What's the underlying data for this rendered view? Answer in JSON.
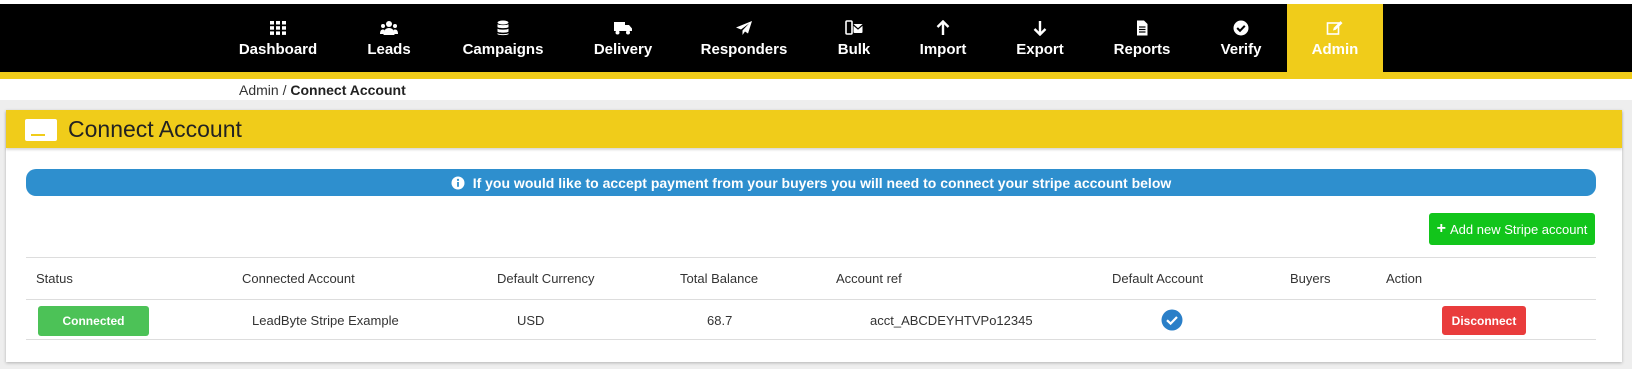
{
  "nav": {
    "items": [
      {
        "label": "Dashboard",
        "icon": "dashboard-icon"
      },
      {
        "label": "Leads",
        "icon": "users-icon"
      },
      {
        "label": "Campaigns",
        "icon": "database-icon"
      },
      {
        "label": "Delivery",
        "icon": "truck-icon"
      },
      {
        "label": "Responders",
        "icon": "paper-plane-icon"
      },
      {
        "label": "Bulk",
        "icon": "bulk-mail-icon"
      },
      {
        "label": "Import",
        "icon": "arrow-up-icon"
      },
      {
        "label": "Export",
        "icon": "arrow-down-icon"
      },
      {
        "label": "Reports",
        "icon": "document-icon"
      },
      {
        "label": "Verify",
        "icon": "check-circle-icon"
      },
      {
        "label": "Admin",
        "icon": "edit-icon"
      }
    ],
    "active": "Admin",
    "colors": {
      "bar": "#000000",
      "active": "#f0cc1a",
      "text": "#ffffff"
    }
  },
  "breadcrumb": {
    "parent": "Admin",
    "separator": " / ",
    "current": "Connect Account"
  },
  "panel": {
    "title": "Connect Account",
    "header_color": "#f0cc1a"
  },
  "info_banner": {
    "text": "If you would like to accept payment from your buyers you will need to connect your stripe account below",
    "icon": "info-circle-icon",
    "color": "#2e8fce"
  },
  "add_button": {
    "label": "Add new Stripe account",
    "icon": "plus-icon",
    "color": "#12c51b"
  },
  "table": {
    "headers": [
      "Status",
      "Connected Account",
      "Default Currency",
      "Total Balance",
      "Account ref",
      "Default Account",
      "Buyers",
      "Action"
    ],
    "rows": [
      {
        "status": "Connected",
        "connected_account": "LeadByte Stripe Example",
        "default_currency": "USD",
        "total_balance": "68.7",
        "account_ref": "acct_ABCDEYHTVPo12345",
        "default_account_icon": "check-circle-icon",
        "buyers": "",
        "action": "Disconnect"
      }
    ]
  }
}
